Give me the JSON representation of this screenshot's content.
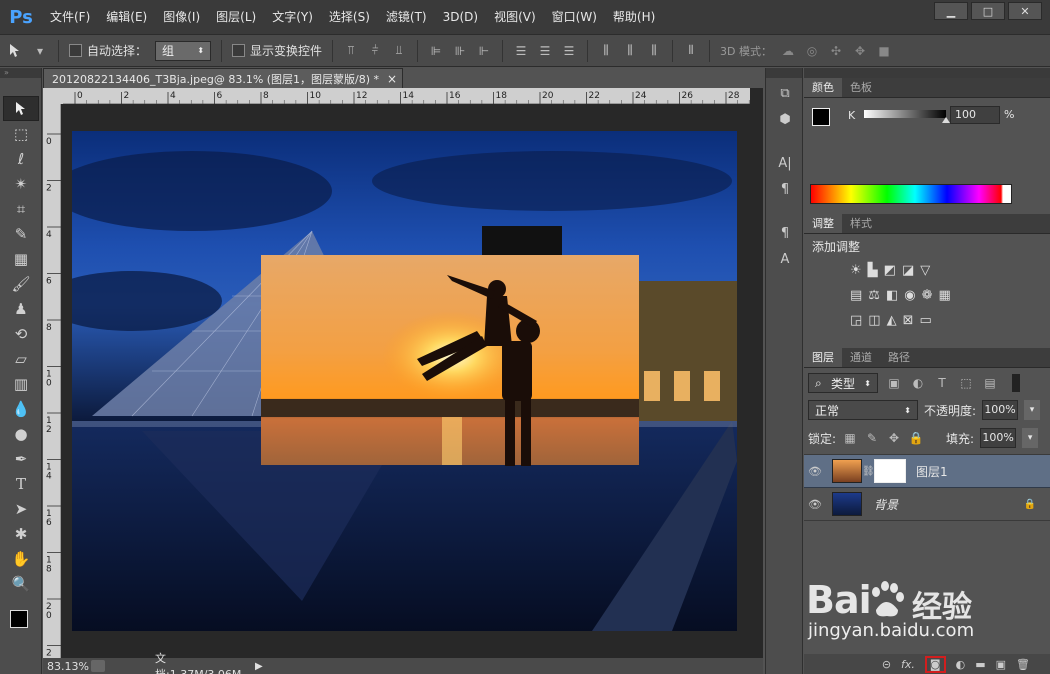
{
  "app": {
    "logo": "Ps",
    "accent": "#4aa3ff"
  },
  "menu": [
    "文件(F)",
    "编辑(E)",
    "图像(I)",
    "图层(L)",
    "文字(Y)",
    "选择(S)",
    "滤镜(T)",
    "3D(D)",
    "视图(V)",
    "窗口(W)",
    "帮助(H)"
  ],
  "window_controls": {
    "minimize": "▁",
    "maximize": "□",
    "close": "✕"
  },
  "options": {
    "auto_select_label": "自动选择：",
    "auto_select_value": "组",
    "show_transform_label": "显示变换控件",
    "mode_3d_label": "3D 模式："
  },
  "document": {
    "tab_title": "20120822134406_T3Bja.jpeg@ 83.1% (图层1，图层蒙版/8) *",
    "close": "×",
    "ruler_top": [
      "0",
      "2",
      "4",
      "6",
      "8",
      "10",
      "12",
      "14",
      "16",
      "18",
      "20",
      "22",
      "24",
      "26",
      "28"
    ],
    "ruler_left": [
      "0",
      "2",
      "4",
      "6",
      "8",
      "1 0",
      "1 2",
      "1 4",
      "1 6",
      "1 8",
      "2 0",
      "2 2"
    ]
  },
  "status": {
    "zoom": "83.13%",
    "doc_info": "文档:1.37M/3.06M"
  },
  "color_panel": {
    "tabs": [
      "颜色",
      "色板"
    ],
    "channel_label": "K",
    "value": "100",
    "unit": "%",
    "k_level_percent": 100
  },
  "adjust_panel": {
    "tabs": [
      "调整",
      "样式"
    ],
    "title": "添加调整"
  },
  "layers_panel": {
    "tabs": [
      "图层",
      "通道",
      "路径"
    ],
    "filter_label": "类型",
    "blend_mode": "正常",
    "opacity_label": "不透明度:",
    "opacity_value": "100%",
    "lock_label": "锁定:",
    "fill_label": "填充:",
    "fill_value": "100%",
    "layers": [
      {
        "name": "图层1",
        "selected": true,
        "has_mask": true
      },
      {
        "name": "背景",
        "selected": false,
        "locked": true
      }
    ],
    "bottom_icons": [
      "link-icon",
      "fx-icon",
      "add-mask-icon",
      "adjustment-icon",
      "folder-icon",
      "new-layer-icon",
      "trash-icon"
    ]
  },
  "watermark": {
    "brand": "Bai",
    "brand2": "经验",
    "url": "jingyan.baidu.com"
  }
}
